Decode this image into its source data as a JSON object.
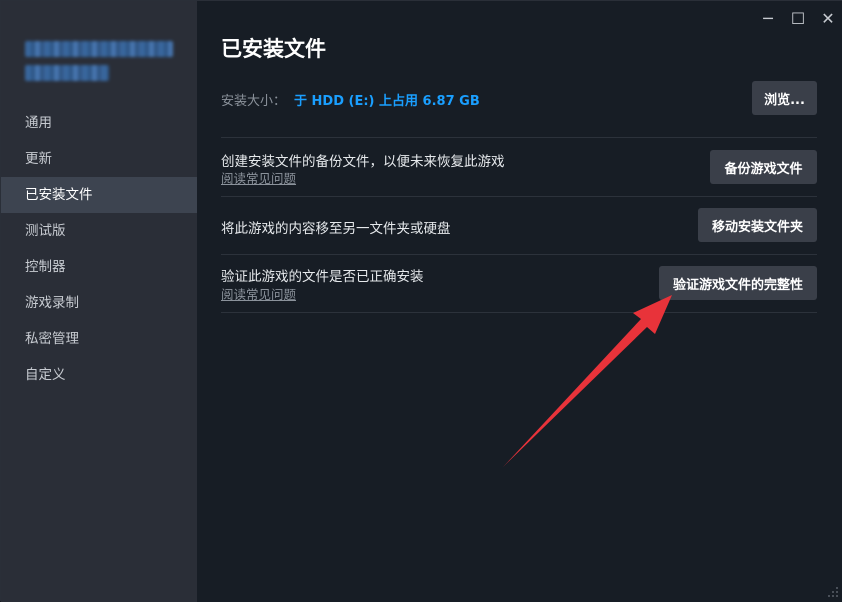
{
  "sidebar": {
    "items": [
      {
        "label": "通用"
      },
      {
        "label": "更新"
      },
      {
        "label": "已安装文件"
      },
      {
        "label": "测试版"
      },
      {
        "label": "控制器"
      },
      {
        "label": "游戏录制"
      },
      {
        "label": "私密管理"
      },
      {
        "label": "自定义"
      }
    ],
    "active_index": 2
  },
  "window_controls": {
    "minimize": "─",
    "maximize": "☐",
    "close": "✕"
  },
  "main": {
    "title": "已安装文件",
    "install_size_label": "安装大小：",
    "install_size_value": "于 HDD (E:) 上占用 6.87 GB",
    "browse_button": "浏览...",
    "rows": [
      {
        "text": "创建安装文件的备份文件，以便未来恢复此游戏",
        "link": "阅读常见问题",
        "button": "备份游戏文件"
      },
      {
        "text": "将此游戏的内容移至另一文件夹或硬盘",
        "button": "移动安装文件夹"
      },
      {
        "text": "验证此游戏的文件是否已正确安装",
        "link": "阅读常见问题",
        "button": "验证游戏文件的完整性"
      }
    ]
  },
  "colors": {
    "accent": "#1a9fff",
    "annotation_arrow": "#e8333a"
  }
}
